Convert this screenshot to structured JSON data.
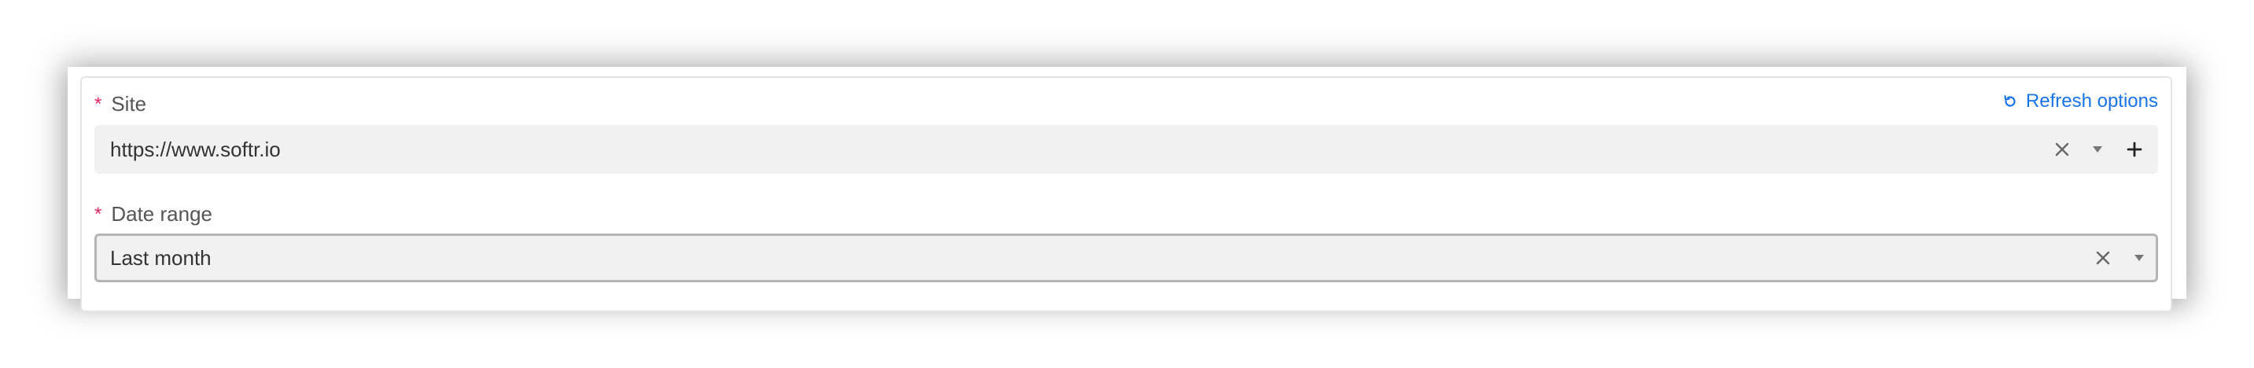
{
  "form": {
    "site": {
      "required_marker": "*",
      "label": "Site",
      "value": "https://www.softr.io"
    },
    "refresh": {
      "label": "Refresh options"
    },
    "date_range": {
      "required_marker": "*",
      "label": "Date range",
      "value": "Last month"
    }
  },
  "colors": {
    "accent": "#1a73e8",
    "required": "#e0245e"
  },
  "icons": {
    "refresh": "refresh-icon",
    "clear": "close-icon",
    "dropdown": "caret-down-icon",
    "add": "plus-icon"
  }
}
